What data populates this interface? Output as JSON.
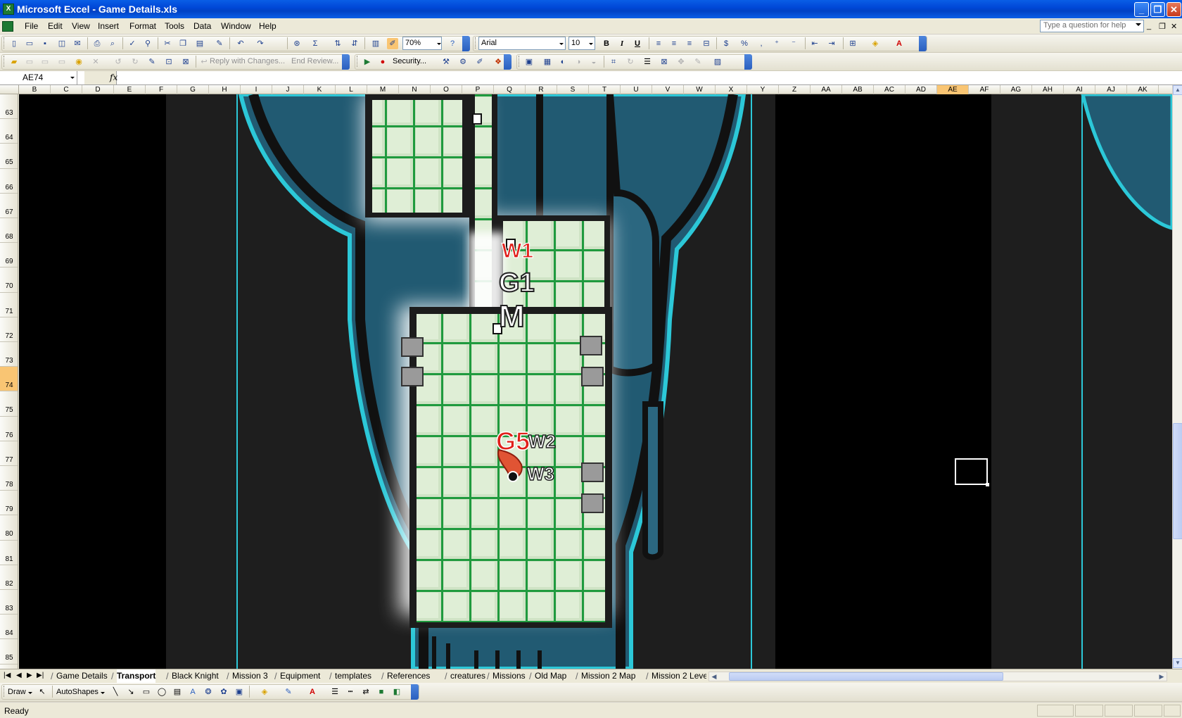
{
  "window": {
    "title": "Microsoft Excel - Game Details.xls",
    "app_icon": "X"
  },
  "window_buttons": {
    "minimize": "_",
    "restore": "❐",
    "close": "✕"
  },
  "menu": [
    "File",
    "Edit",
    "View",
    "Insert",
    "Format",
    "Tools",
    "Data",
    "Window",
    "Help"
  ],
  "help_box": {
    "placeholder": "Type a question for help"
  },
  "toolbar": {
    "zoom": "70%",
    "font": "Arial",
    "font_size": "10",
    "bold": "B",
    "italic": "I",
    "underline": "U",
    "percent": "%",
    "comma": ",",
    "sum": "Σ"
  },
  "reviewing": {
    "reply_with_changes": "Reply with Changes...",
    "end_review": "End Review...",
    "security": "Security..."
  },
  "formula_bar": {
    "name_box": "AE74",
    "fx": "fx",
    "content": ""
  },
  "columns": [
    "B",
    "C",
    "D",
    "E",
    "F",
    "G",
    "H",
    "I",
    "J",
    "K",
    "L",
    "M",
    "N",
    "O",
    "P",
    "Q",
    "R",
    "S",
    "T",
    "U",
    "V",
    "W",
    "X",
    "Y",
    "Z",
    "AA",
    "AB",
    "AC",
    "AD",
    "AE",
    "AF",
    "AG",
    "AH",
    "AI",
    "AJ",
    "AK"
  ],
  "active_column": "AE",
  "rows": [
    "63",
    "64",
    "65",
    "66",
    "67",
    "68",
    "69",
    "70",
    "71",
    "72",
    "73",
    "74",
    "75",
    "76",
    "77",
    "78",
    "79",
    "80",
    "81",
    "82",
    "83",
    "84",
    "85"
  ],
  "active_row": "74",
  "map_labels": {
    "w1": "W1",
    "g1": "G1",
    "m": "M",
    "g5": "G5",
    "w2": "W2",
    "w3": "W3"
  },
  "map_colors": {
    "hull": "#215a72",
    "outline": "#2cc8d8",
    "floor": "#cfe3c5",
    "grid_line": "#1f9a3e",
    "wall": "#1c1c1c",
    "background": "#000000",
    "panel": "#1e1e1e",
    "red_label": "#e0201a"
  },
  "sheet_nav": [
    "|◀",
    "◀",
    "▶",
    "▶|"
  ],
  "sheet_tabs": [
    "Game Details",
    "Transport",
    "Black Knight",
    "Mission 3",
    "Equipment",
    "templates",
    "References",
    "creatures",
    "Missions",
    "Old Map",
    "Mission 2 Map",
    "Mission 2 Leve"
  ],
  "active_sheet": "Transport",
  "draw_toolbar": {
    "draw": "Draw",
    "autoshapes": "AutoShapes"
  },
  "status": {
    "text": "Ready"
  }
}
